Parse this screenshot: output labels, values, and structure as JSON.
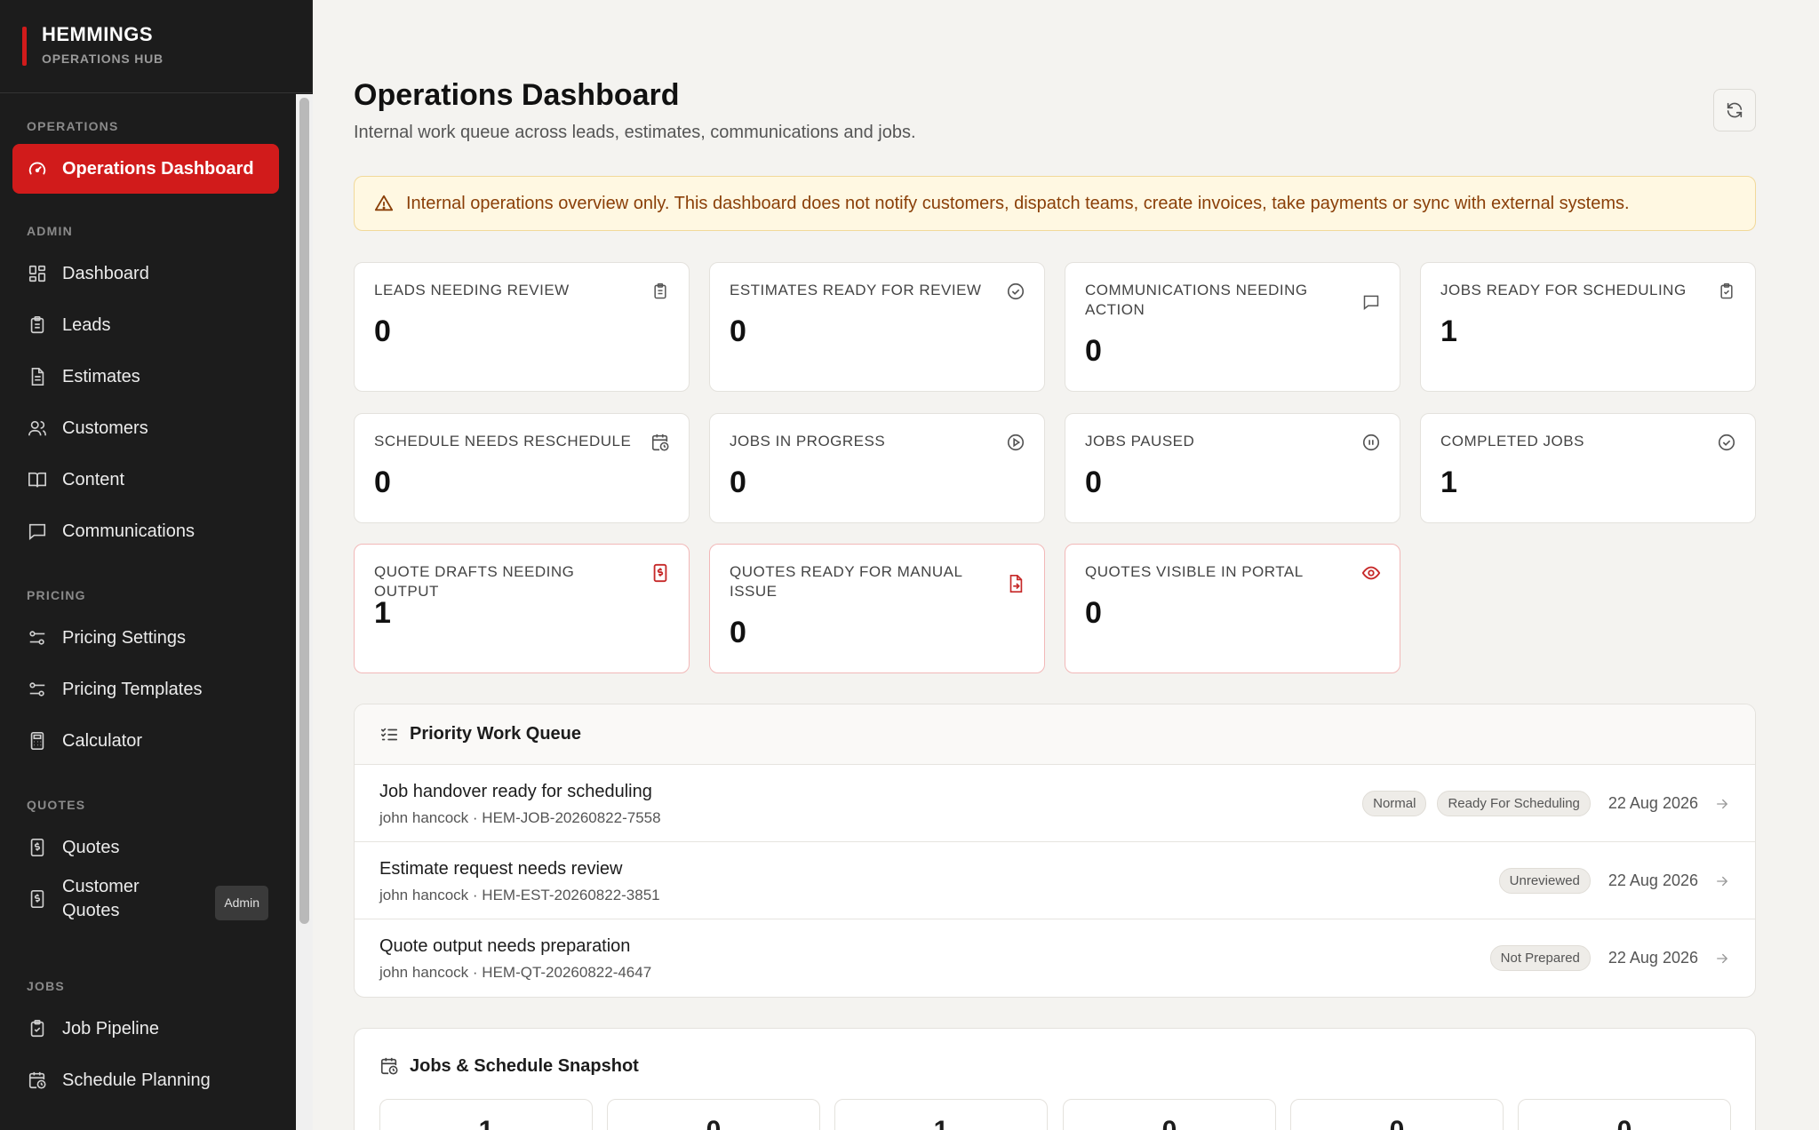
{
  "brand": {
    "title": "HEMMINGS",
    "subtitle": "OPERATIONS HUB"
  },
  "sidebar": {
    "sections": {
      "operations": "OPERATIONS",
      "admin": "ADMIN",
      "pricing": "PRICING",
      "quotes": "QUOTES",
      "jobs": "JOBS"
    },
    "items": {
      "operations_dashboard": "Operations Dashboard",
      "dashboard": "Dashboard",
      "leads": "Leads",
      "estimates": "Estimates",
      "customers": "Customers",
      "content": "Content",
      "communications": "Communications",
      "pricing_settings": "Pricing Settings",
      "pricing_templates": "Pricing Templates",
      "calculator": "Calculator",
      "quotes": "Quotes",
      "customer_quotes_line1": "Customer",
      "customer_quotes_line2": "Quotes",
      "customer_quotes_badge": "Admin",
      "job_pipeline": "Job Pipeline",
      "schedule_planning": "Schedule Planning"
    },
    "accent_color": "#d11b1b"
  },
  "page": {
    "title": "Operations Dashboard",
    "subtitle": "Internal work queue across leads, estimates, communications and jobs.",
    "notice": "Internal operations overview only. This dashboard does not notify customers, dispatch teams, create invoices, take payments or sync with external systems."
  },
  "cards": {
    "leads_needing_review": {
      "label": "LEADS NEEDING REVIEW",
      "value": "0",
      "icon": "clipboard-icon"
    },
    "estimates_ready": {
      "label": "ESTIMATES READY FOR REVIEW",
      "value": "0",
      "icon": "check-circle-icon"
    },
    "communications_action": {
      "label": "COMMUNICATIONS NEEDING ACTION",
      "value": "0",
      "icon": "message-icon"
    },
    "jobs_ready_scheduling": {
      "label": "JOBS READY FOR SCHEDULING",
      "value": "1",
      "icon": "clipboard-check-icon"
    },
    "schedule_reschedule": {
      "label": "SCHEDULE NEEDS RESCHEDULE",
      "value": "0",
      "icon": "calendar-clock-icon"
    },
    "jobs_in_progress": {
      "label": "JOBS IN PROGRESS",
      "value": "0",
      "icon": "play-circle-icon"
    },
    "jobs_paused": {
      "label": "JOBS PAUSED",
      "value": "0",
      "icon": "pause-circle-icon"
    },
    "completed_jobs": {
      "label": "COMPLETED JOBS",
      "value": "1",
      "icon": "check-circle-icon"
    },
    "quote_drafts_output": {
      "label": "QUOTE DRAFTS NEEDING OUTPUT",
      "value": "1",
      "icon": "dollar-receipt-icon"
    },
    "quotes_ready_manual": {
      "label": "QUOTES READY FOR MANUAL ISSUE",
      "value": "0",
      "icon": "file-arrow-icon"
    },
    "quotes_visible_portal": {
      "label": "QUOTES VISIBLE IN PORTAL",
      "value": "0",
      "icon": "eye-icon"
    }
  },
  "queue": {
    "title": "Priority Work Queue",
    "rows": [
      {
        "title": "Job handover ready for scheduling",
        "sub": "john hancock · HEM-JOB-20260822-7558",
        "pill1": "Normal",
        "pill2": "Ready For Scheduling",
        "date": "22 Aug 2026"
      },
      {
        "title": "Estimate request needs review",
        "sub": "john hancock · HEM-EST-20260822-3851",
        "pill1": "Unreviewed",
        "date": "22 Aug 2026"
      },
      {
        "title": "Quote output needs preparation",
        "sub": "john hancock · HEM-QT-20260822-4647",
        "pill1": "Not Prepared",
        "date": "22 Aug 2026"
      }
    ]
  },
  "snapshot": {
    "title": "Jobs & Schedule Snapshot",
    "values": [
      "1",
      "0",
      "1",
      "0",
      "0",
      "0"
    ]
  }
}
